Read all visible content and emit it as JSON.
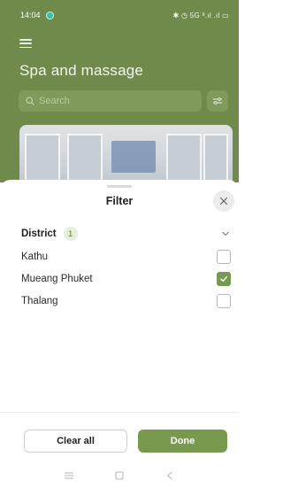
{
  "status_bar": {
    "time": "14:04",
    "indicators": "✱ ◷ 5G ᴵᴵ.ıl .ıl ▭"
  },
  "header": {
    "title": "Spa and massage",
    "menu_icon": "hamburger-icon"
  },
  "search": {
    "placeholder": "Search",
    "icon": "search-icon"
  },
  "filter_button": {
    "icon": "filter-icon"
  },
  "sheet": {
    "title": "Filter",
    "close_icon": "close-icon",
    "district": {
      "label": "District",
      "count": "1",
      "chevron_icon": "chevron-down-icon"
    },
    "options": [
      {
        "label": "Kathu",
        "checked": false
      },
      {
        "label": "Mueang Phuket",
        "checked": true
      },
      {
        "label": "Thalang",
        "checked": false
      }
    ],
    "actions": {
      "clear_label": "Clear all",
      "done_label": "Done"
    }
  },
  "nav_bar": {
    "icons": [
      "menu-nav-icon",
      "home-nav-icon",
      "back-nav-icon"
    ]
  },
  "colors": {
    "brand_green": "#6f8a4b",
    "accent_green": "#79994f",
    "badge_bg": "#e6efd9"
  }
}
